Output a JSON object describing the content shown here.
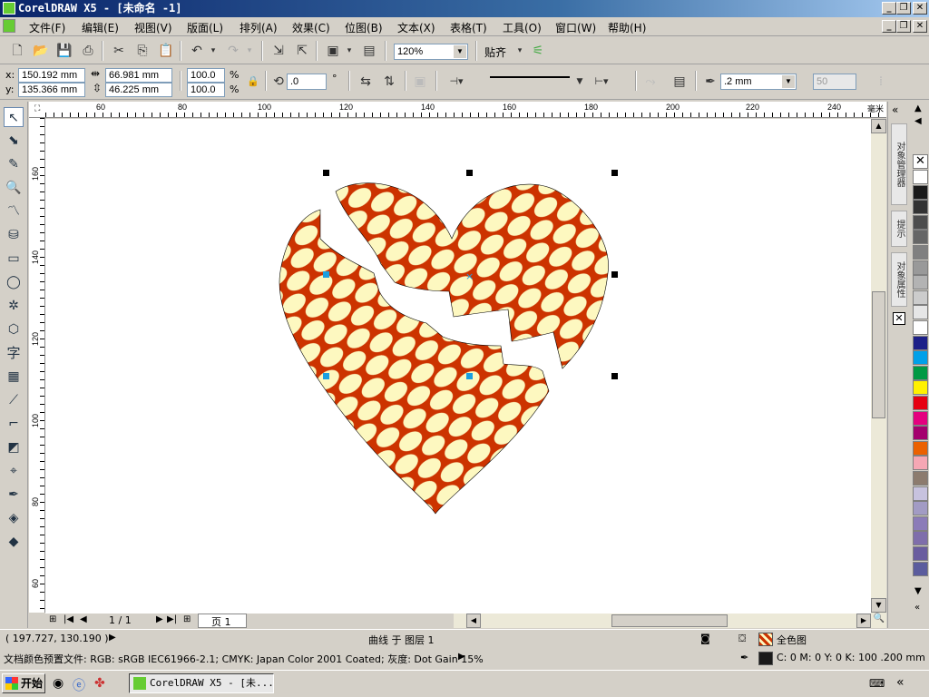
{
  "app_title": "CorelDRAW X5 - [未命名 -1]",
  "menu": [
    "文件(F)",
    "编辑(E)",
    "视图(V)",
    "版面(L)",
    "排列(A)",
    "效果(C)",
    "位图(B)",
    "文本(X)",
    "表格(T)",
    "工具(O)",
    "窗口(W)",
    "帮助(H)"
  ],
  "toolbar": {
    "zoom": "120%",
    "snap_label": "贴齐"
  },
  "props": {
    "x_label": "x:",
    "y_label": "y:",
    "x": "150.192 mm",
    "y": "135.366 mm",
    "w": "66.981 mm",
    "h": "46.225 mm",
    "scale_w": "100.0",
    "scale_h": "100.0",
    "pct": "%",
    "angle": ".0",
    "deg": "°",
    "outline_width": ".2 mm",
    "miter": "50"
  },
  "ruler": {
    "h_labels": [
      "60",
      "80",
      "100",
      "120",
      "140",
      "160",
      "180",
      "200",
      "220",
      "240"
    ],
    "v_labels": [
      "160",
      "140",
      "120",
      "100",
      "80",
      "60"
    ],
    "unit": "毫米"
  },
  "docker_tabs": [
    "对象管理器",
    "提示",
    "对象属性"
  ],
  "palette_colors": [
    "#ffffff",
    "#1a1a1a",
    "#333333",
    "#4d4d4d",
    "#666666",
    "#808080",
    "#999999",
    "#b3b3b3",
    "#cccccc",
    "#e6e6e6",
    "#ffffff",
    "#1d2088",
    "#00a0e9",
    "#009944",
    "#fff100",
    "#e60012",
    "#e4007f",
    "#a4006e",
    "#eb6100",
    "#f5a7b4",
    "#8c7b6e",
    "#c7c2de",
    "#a29bc4",
    "#8b7bb8",
    "#7f6eab",
    "#6a5d9f",
    "#5b5c9d"
  ],
  "page_nav": {
    "count": "1 / 1",
    "tab": "页 1"
  },
  "status": {
    "coords": "( 197.727, 130.190 )",
    "object": "曲线 于 图层 1",
    "fill_label": "全色图",
    "profile": "文档颜色预置文件: RGB: sRGB IEC61966-2.1; CMYK: Japan Color 2001 Coated; 灰度: Dot Gain 15%",
    "outline": "C: 0 M: 0 Y: 0 K: 100  .200 mm"
  },
  "taskbar": {
    "start": "开始",
    "task": "CorelDRAW X5 - [未..."
  },
  "colors": {
    "heart_fill": "#cc3300",
    "pattern": "#fdf8c0"
  }
}
